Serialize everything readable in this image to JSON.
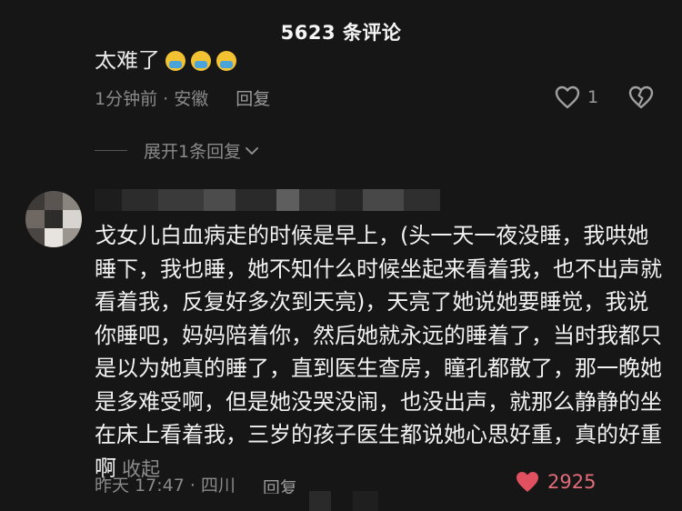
{
  "header": {
    "title": "5623 条评论"
  },
  "prev_comment": {
    "text_fragment": "太难了",
    "emoji_count": 3,
    "time_location": "1分钟前 · 安徽",
    "reply_label": "回复",
    "like_count": "1",
    "expand_label": "展开1条回复"
  },
  "main_comment": {
    "body": "戈女儿白血病走的时候是早上，(头一天一夜没睡，我哄她睡下，我也睡，她不知什么时候坐起来看着我，也不出声就看着我，反复好多次到天亮)，天亮了她说她要睡觉，我说你睡吧，妈妈陪着你，然后她就永远的睡着了，当时我都只是以为她真的睡了，直到医生查房，瞳孔都散了，那一晚她是多难受啊，但是她没哭没闹，也没出声，就那么静静的坐在床上看着我，三岁的孩子医生都说她心思好重，真的好重啊",
    "collapse_label": "收起",
    "time_location": "昨天 17:47 · 四川",
    "reply_label": "回复",
    "like_count": "2925"
  },
  "colors": {
    "background": "#161616",
    "text": "#f2f2f2",
    "muted": "#8a8a8a",
    "like_red": "#e0505f"
  },
  "icons": [
    "heart-outline-icon",
    "broken-heart-icon",
    "chevron-down-icon",
    "heart-filled-icon"
  ]
}
